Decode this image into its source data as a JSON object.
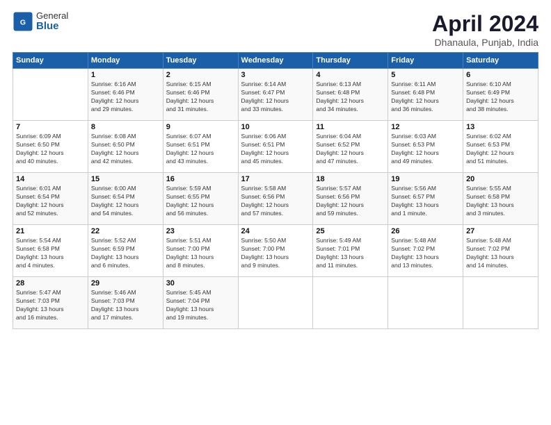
{
  "logo": {
    "general": "General",
    "blue": "Blue"
  },
  "header": {
    "title": "April 2024",
    "subtitle": "Dhanaula, Punjab, India"
  },
  "columns": [
    "Sunday",
    "Monday",
    "Tuesday",
    "Wednesday",
    "Thursday",
    "Friday",
    "Saturday"
  ],
  "weeks": [
    [
      {
        "day": "",
        "info": ""
      },
      {
        "day": "1",
        "info": "Sunrise: 6:16 AM\nSunset: 6:46 PM\nDaylight: 12 hours\nand 29 minutes."
      },
      {
        "day": "2",
        "info": "Sunrise: 6:15 AM\nSunset: 6:46 PM\nDaylight: 12 hours\nand 31 minutes."
      },
      {
        "day": "3",
        "info": "Sunrise: 6:14 AM\nSunset: 6:47 PM\nDaylight: 12 hours\nand 33 minutes."
      },
      {
        "day": "4",
        "info": "Sunrise: 6:13 AM\nSunset: 6:48 PM\nDaylight: 12 hours\nand 34 minutes."
      },
      {
        "day": "5",
        "info": "Sunrise: 6:11 AM\nSunset: 6:48 PM\nDaylight: 12 hours\nand 36 minutes."
      },
      {
        "day": "6",
        "info": "Sunrise: 6:10 AM\nSunset: 6:49 PM\nDaylight: 12 hours\nand 38 minutes."
      }
    ],
    [
      {
        "day": "7",
        "info": "Sunrise: 6:09 AM\nSunset: 6:50 PM\nDaylight: 12 hours\nand 40 minutes."
      },
      {
        "day": "8",
        "info": "Sunrise: 6:08 AM\nSunset: 6:50 PM\nDaylight: 12 hours\nand 42 minutes."
      },
      {
        "day": "9",
        "info": "Sunrise: 6:07 AM\nSunset: 6:51 PM\nDaylight: 12 hours\nand 43 minutes."
      },
      {
        "day": "10",
        "info": "Sunrise: 6:06 AM\nSunset: 6:51 PM\nDaylight: 12 hours\nand 45 minutes."
      },
      {
        "day": "11",
        "info": "Sunrise: 6:04 AM\nSunset: 6:52 PM\nDaylight: 12 hours\nand 47 minutes."
      },
      {
        "day": "12",
        "info": "Sunrise: 6:03 AM\nSunset: 6:53 PM\nDaylight: 12 hours\nand 49 minutes."
      },
      {
        "day": "13",
        "info": "Sunrise: 6:02 AM\nSunset: 6:53 PM\nDaylight: 12 hours\nand 51 minutes."
      }
    ],
    [
      {
        "day": "14",
        "info": "Sunrise: 6:01 AM\nSunset: 6:54 PM\nDaylight: 12 hours\nand 52 minutes."
      },
      {
        "day": "15",
        "info": "Sunrise: 6:00 AM\nSunset: 6:54 PM\nDaylight: 12 hours\nand 54 minutes."
      },
      {
        "day": "16",
        "info": "Sunrise: 5:59 AM\nSunset: 6:55 PM\nDaylight: 12 hours\nand 56 minutes."
      },
      {
        "day": "17",
        "info": "Sunrise: 5:58 AM\nSunset: 6:56 PM\nDaylight: 12 hours\nand 57 minutes."
      },
      {
        "day": "18",
        "info": "Sunrise: 5:57 AM\nSunset: 6:56 PM\nDaylight: 12 hours\nand 59 minutes."
      },
      {
        "day": "19",
        "info": "Sunrise: 5:56 AM\nSunset: 6:57 PM\nDaylight: 13 hours\nand 1 minute."
      },
      {
        "day": "20",
        "info": "Sunrise: 5:55 AM\nSunset: 6:58 PM\nDaylight: 13 hours\nand 3 minutes."
      }
    ],
    [
      {
        "day": "21",
        "info": "Sunrise: 5:54 AM\nSunset: 6:58 PM\nDaylight: 13 hours\nand 4 minutes."
      },
      {
        "day": "22",
        "info": "Sunrise: 5:52 AM\nSunset: 6:59 PM\nDaylight: 13 hours\nand 6 minutes."
      },
      {
        "day": "23",
        "info": "Sunrise: 5:51 AM\nSunset: 7:00 PM\nDaylight: 13 hours\nand 8 minutes."
      },
      {
        "day": "24",
        "info": "Sunrise: 5:50 AM\nSunset: 7:00 PM\nDaylight: 13 hours\nand 9 minutes."
      },
      {
        "day": "25",
        "info": "Sunrise: 5:49 AM\nSunset: 7:01 PM\nDaylight: 13 hours\nand 11 minutes."
      },
      {
        "day": "26",
        "info": "Sunrise: 5:48 AM\nSunset: 7:02 PM\nDaylight: 13 hours\nand 13 minutes."
      },
      {
        "day": "27",
        "info": "Sunrise: 5:48 AM\nSunset: 7:02 PM\nDaylight: 13 hours\nand 14 minutes."
      }
    ],
    [
      {
        "day": "28",
        "info": "Sunrise: 5:47 AM\nSunset: 7:03 PM\nDaylight: 13 hours\nand 16 minutes."
      },
      {
        "day": "29",
        "info": "Sunrise: 5:46 AM\nSunset: 7:03 PM\nDaylight: 13 hours\nand 17 minutes."
      },
      {
        "day": "30",
        "info": "Sunrise: 5:45 AM\nSunset: 7:04 PM\nDaylight: 13 hours\nand 19 minutes."
      },
      {
        "day": "",
        "info": ""
      },
      {
        "day": "",
        "info": ""
      },
      {
        "day": "",
        "info": ""
      },
      {
        "day": "",
        "info": ""
      }
    ]
  ]
}
